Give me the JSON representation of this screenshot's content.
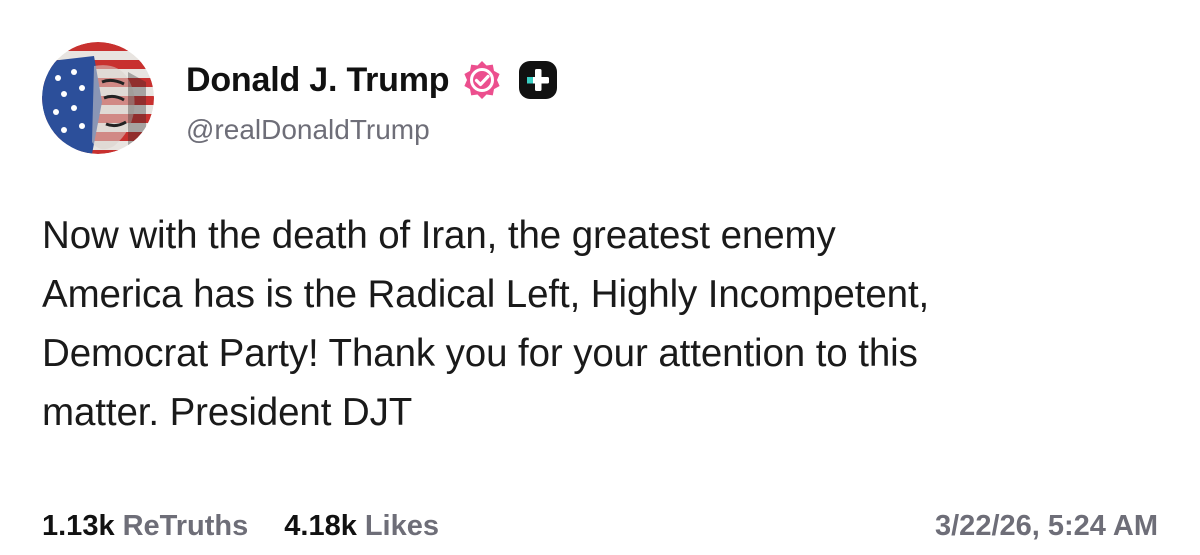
{
  "author": {
    "display_name": "Donald J. Trump",
    "handle": "@realDonaldTrump",
    "avatar_icon": "flag-painted-portrait-avatar",
    "verified_icon": "verified-badge-icon",
    "verified_color": "#ec4f8e",
    "plus_icon": "plus-badge-icon"
  },
  "post": {
    "lines": [
      "Now with the death of Iran, the greatest enemy",
      "America has is the Radical Left, Highly Incompetent,",
      "Democrat Party! Thank you for your attention to this",
      "matter. President DJT"
    ]
  },
  "stats": {
    "retruths_count": "1.13k",
    "retruths_label": "ReTruths",
    "likes_count": "4.18k",
    "likes_label": "Likes"
  },
  "timestamp": "3/22/26, 5:24 AM"
}
